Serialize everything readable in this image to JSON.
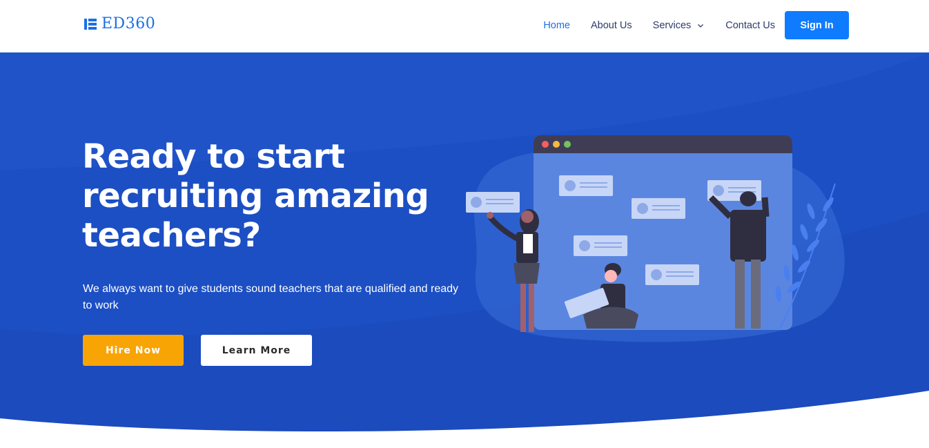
{
  "brand": {
    "name": "ED360",
    "accent": "#1a6fe8"
  },
  "nav": {
    "items": [
      {
        "label": "Home",
        "active": true
      },
      {
        "label": "About Us",
        "active": false
      },
      {
        "label": "Services",
        "active": false,
        "has_dropdown": true
      },
      {
        "label": "Contact Us",
        "active": false
      }
    ],
    "signin_label": "Sign In"
  },
  "hero": {
    "headline": "Ready to start recruiting amazing teachers?",
    "subtext": "We always want to give students sound teachers that are qualified and ready to work",
    "primary_button": "Hire Now",
    "secondary_button": "Learn More",
    "colors": {
      "background": "#1c4fc4",
      "primary_button": "#f9a405",
      "secondary_button": "#ffffff"
    }
  },
  "illustration": {
    "name": "recruiting-team-illustration"
  }
}
